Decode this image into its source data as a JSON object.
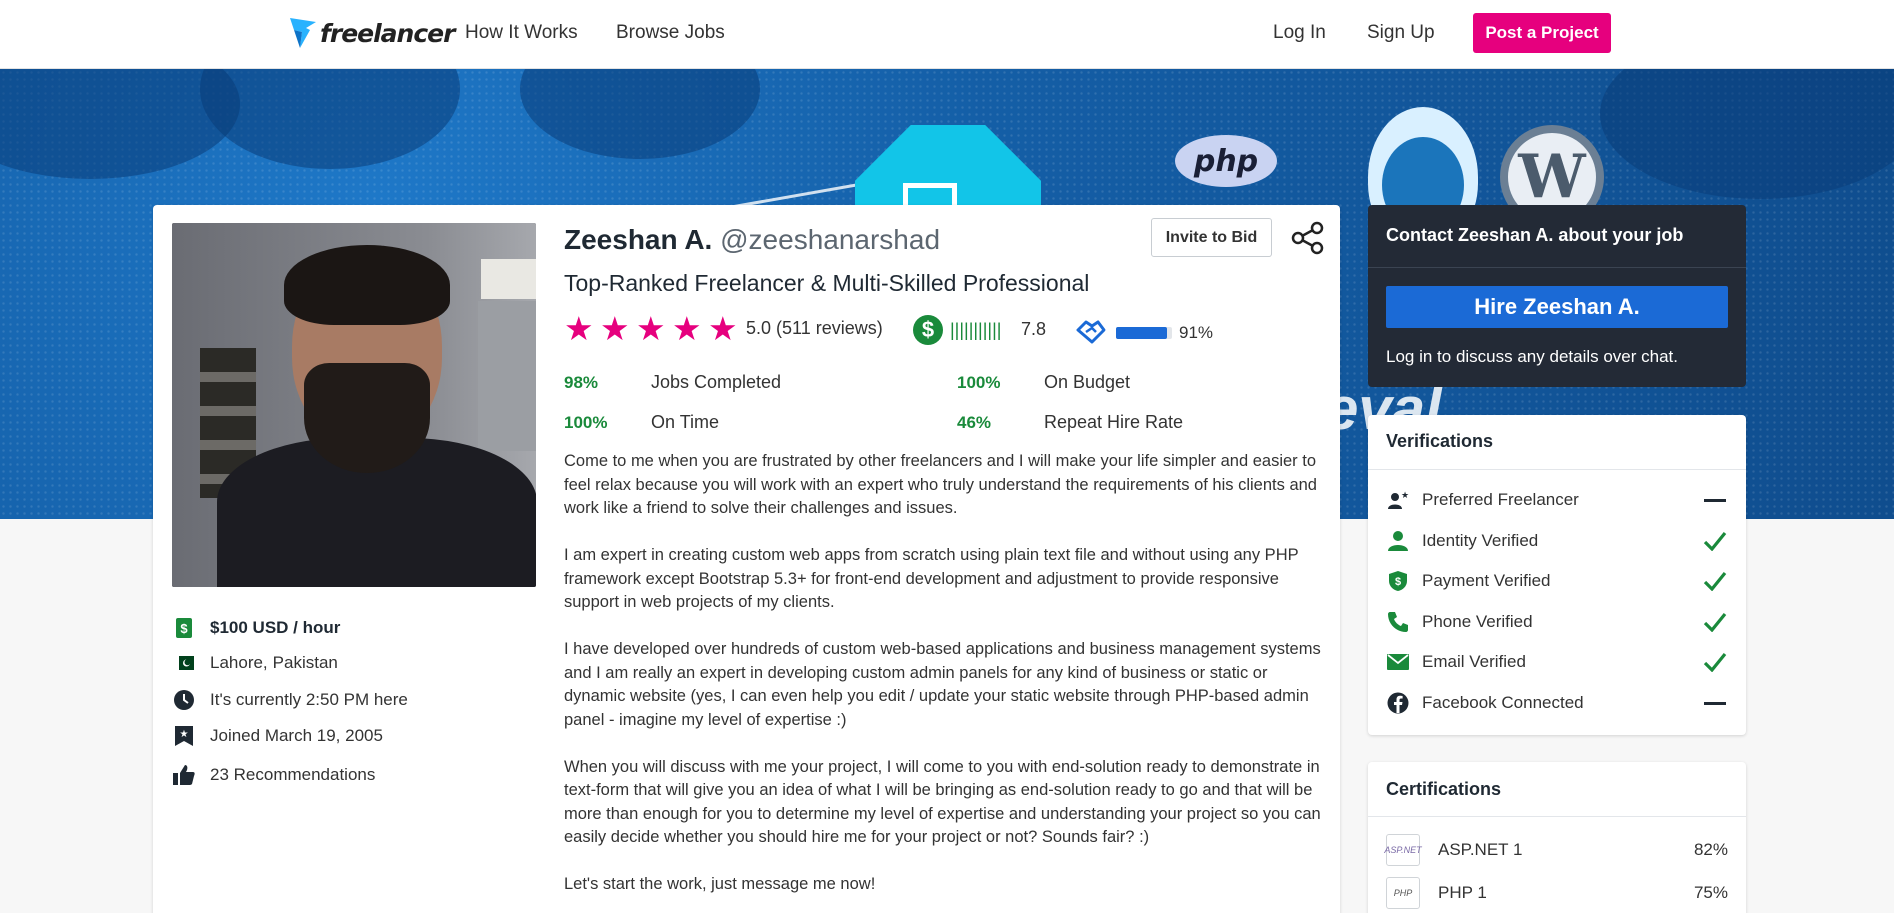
{
  "nav": {
    "logo_text": "freelancer",
    "how_it_works": "How It Works",
    "browse_jobs": "Browse Jobs",
    "log_in": "Log In",
    "sign_up": "Sign Up",
    "post_project": "Post a Project"
  },
  "banner": {
    "php_text": "php",
    "wp_text": "W",
    "overlay_text": "eval"
  },
  "profile": {
    "name": "Zeeshan A.",
    "handle": "@zeeshanarshad",
    "title": "Top-Ranked Freelancer & Multi-Skilled Professional",
    "invite_label": "Invite to Bid",
    "rating_stars": 5,
    "rating_text": "5.0 (511 reviews)",
    "earnings_score": "7.8",
    "earnings_bars": "|||||||||||",
    "rehire_percent": 0.91,
    "rehire_text": "91%",
    "stats": [
      {
        "pct": "98%",
        "label": "Jobs Completed"
      },
      {
        "pct": "100%",
        "label": "On Budget"
      },
      {
        "pct": "100%",
        "label": "On Time"
      },
      {
        "pct": "46%",
        "label": "Repeat Hire Rate"
      }
    ],
    "about": [
      "Come to me when you are frustrated by other freelancers and I will make your life simpler and easier to feel relax because you will work with an expert who truly understand the requirements of his clients and work like a friend to solve their challenges and issues.",
      "I am expert in creating custom web apps from scratch using plain text file and without using any PHP framework except Bootstrap 5.3+ for front-end development and adjustment to provide responsive support in web projects of my clients.",
      "I have developed over hundreds of custom web-based applications and business management systems and I am really an expert in developing custom admin panels for any kind of business or static or dynamic website (yes, I can even help you edit / update your static website through PHP-based admin panel - imagine my level of expertise :)",
      "When you will discuss with me your project, I will come to you with end-solution ready to demonstrate in text-form that will give you an idea of what I will be bringing as end-solution ready to go and that will be more than enough for you to determine my level of expertise and understanding your project so you can easily decide whether you should hire me for your project or not? Sounds fair? :)",
      "Let's start the work, just message me now!"
    ],
    "facts": {
      "rate": "$100 USD / hour",
      "city": "Lahore,",
      "country": "Pakistan",
      "local_time": "It's currently 2:50 PM here",
      "joined": "Joined March 19, 2005",
      "recommendations": "23 Recommendations"
    }
  },
  "contact": {
    "title": "Contact Zeeshan A. about your job",
    "hire_label": "Hire Zeeshan A.",
    "note": "Log in to discuss any details over chat."
  },
  "verifications": {
    "title": "Verifications",
    "items": [
      {
        "label": "Preferred Freelancer",
        "icon": "preferred-freelancer-icon",
        "verified": false
      },
      {
        "label": "Identity Verified",
        "icon": "person-icon",
        "verified": true
      },
      {
        "label": "Payment Verified",
        "icon": "shield-dollar-icon",
        "verified": true
      },
      {
        "label": "Phone Verified",
        "icon": "phone-icon",
        "verified": true
      },
      {
        "label": "Email Verified",
        "icon": "envelope-icon",
        "verified": true
      },
      {
        "label": "Facebook Connected",
        "icon": "facebook-icon",
        "verified": false
      }
    ]
  },
  "certifications": {
    "title": "Certifications",
    "items": [
      {
        "badge": "ASP.NET",
        "label": "ASP.NET 1",
        "pct": "82%"
      },
      {
        "badge": "PHP",
        "label": "PHP 1",
        "pct": "75%"
      }
    ]
  },
  "colors": {
    "brand_pink": "#e6007e",
    "brand_blue": "#1b6ad6",
    "success_green": "#1a8a3b",
    "dark_panel": "#232a36"
  }
}
